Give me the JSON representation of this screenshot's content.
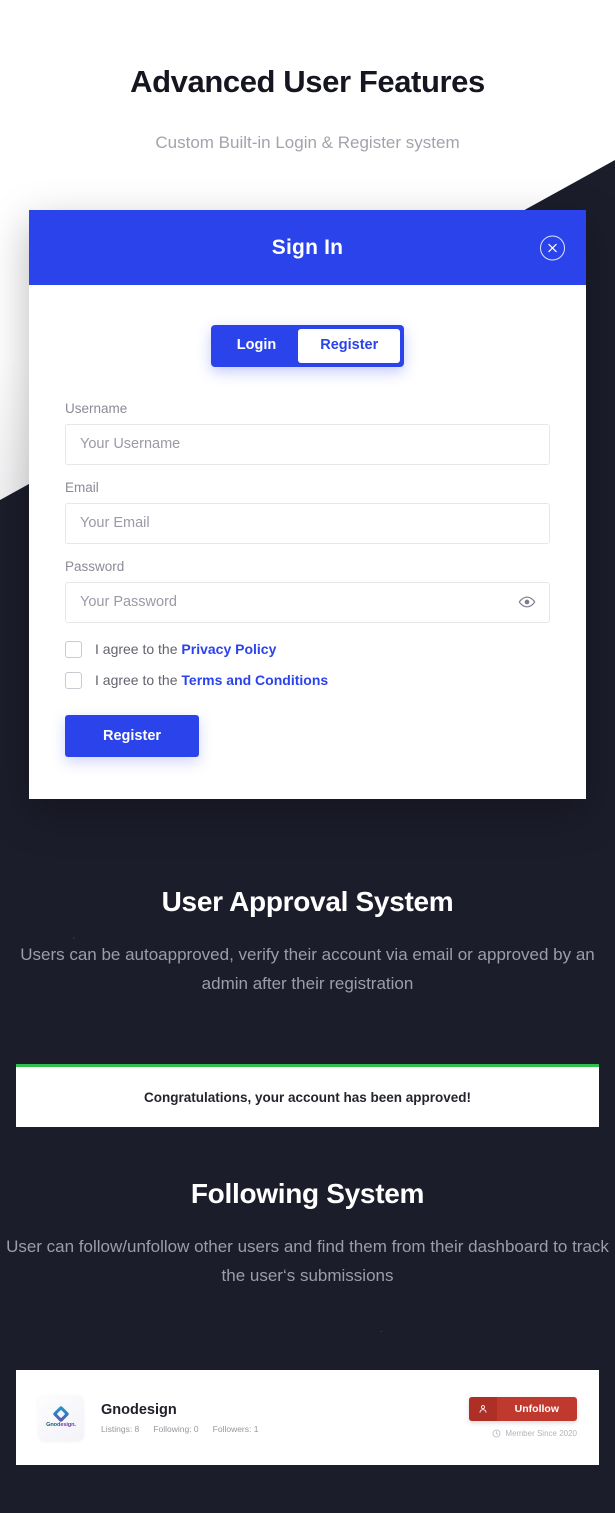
{
  "hero": {
    "title": "Advanced User Features",
    "subtitle": "Custom Built-in Login & Register system"
  },
  "modal": {
    "title": "Sign In",
    "close_icon": "close-circle-icon",
    "tabs": [
      {
        "label": "Login",
        "active": false
      },
      {
        "label": "Register",
        "active": true
      }
    ],
    "fields": [
      {
        "label": "Username",
        "placeholder": "Your Username",
        "value": ""
      },
      {
        "label": "Email",
        "placeholder": "Your Email",
        "value": ""
      },
      {
        "label": "Password",
        "placeholder": "Your Password",
        "value": "",
        "icon": "eye-icon"
      }
    ],
    "agreements": [
      {
        "prefix": "I agree to the",
        "link": "Privacy Policy",
        "checked": false
      },
      {
        "prefix": "I agree to the",
        "link": "Terms and Conditions",
        "checked": false
      }
    ],
    "submit_label": "Register"
  },
  "approval": {
    "title": "User Approval System",
    "description": "Users can be autoapproved, verify their account via email or approved by an admin after their registration",
    "toast_text": "Congratulations, your account has been approved!",
    "toast_accent": "#2ec24a"
  },
  "following": {
    "title": "Following System",
    "description": "User can follow/unfollow other users and find them from their dashboard to track the user‘s submissions",
    "card": {
      "avatar_brand_a": "Gno",
      "avatar_brand_b": "design.",
      "name": "Gnodesign",
      "stats": [
        "Listings: 8",
        "Following: 0",
        "Followers: 1"
      ],
      "unfollow_label": "Unfollow",
      "unfollow_icon": "user-minus-icon",
      "member_since": "Member Since 2020",
      "member_icon": "clock-icon"
    }
  },
  "colors": {
    "brand_blue": "#2b43ea",
    "dark_bg": "#1c1d2b",
    "success_green": "#2ec24a",
    "danger_red": "#c0392f"
  }
}
